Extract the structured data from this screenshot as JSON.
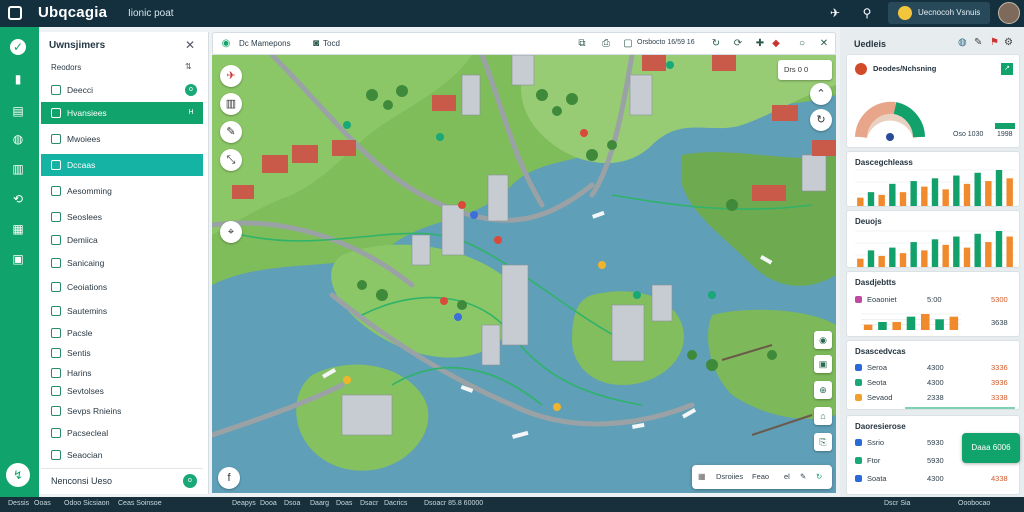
{
  "app": {
    "title": "Ubqcagia",
    "menu": "Iionic poat"
  },
  "topbar": {
    "user_label": "Uecnocoh Vsnuis"
  },
  "sidebar": {
    "title": "Uwnsjimers",
    "section": "Reodors",
    "items": [
      {
        "label": "Deecci",
        "badge": "o",
        "state": ""
      },
      {
        "label": "Hvansiees",
        "badge": "H",
        "state": "sel1"
      },
      {
        "label": "Mwoiees",
        "badge": "",
        "state": ""
      },
      {
        "label": "Dccaas",
        "badge": "",
        "state": "sel2"
      },
      {
        "label": "Aesomming",
        "badge": "",
        "state": ""
      },
      {
        "label": "Seoslees",
        "badge": "",
        "state": ""
      },
      {
        "label": "Demiica",
        "badge": "",
        "state": ""
      },
      {
        "label": "Sanicaing",
        "badge": "",
        "state": ""
      },
      {
        "label": "Ceoiations",
        "badge": "",
        "state": ""
      },
      {
        "label": "Sautemins",
        "badge": "",
        "state": ""
      },
      {
        "label": "Pacsle",
        "badge": "",
        "state": ""
      },
      {
        "label": "Sentis",
        "badge": "",
        "state": ""
      },
      {
        "label": "Harins",
        "badge": "",
        "state": ""
      },
      {
        "label": "Sevtolses",
        "badge": "",
        "state": ""
      },
      {
        "label": "Sevps Rnieins",
        "badge": "",
        "state": ""
      },
      {
        "label": "Pacsecleal",
        "badge": "",
        "state": ""
      },
      {
        "label": "Seaocian",
        "badge": "",
        "state": ""
      }
    ],
    "footer": "Nenconsi Ueso",
    "footer_badge": "o"
  },
  "toolbar": {
    "title": "Dc Mamepons",
    "tag": "Tocd",
    "range": "Orsbocto 16/59 16"
  },
  "map": {
    "chip": "Drs 0 0",
    "legend": [
      "Dsroiies",
      "Feao",
      "el"
    ]
  },
  "right": {
    "title": "Uedleis",
    "card1": {
      "title": "Deodes/Nchsning",
      "left": "Oso 1030",
      "right": "1998"
    },
    "card2": {
      "title": "Dascegchleass"
    },
    "card3": {
      "title": "Deuojs"
    },
    "card4": {
      "title": "Dasdjebtts",
      "row": {
        "name": "Eoaoniet",
        "v1": "5:00",
        "v2": "5300"
      },
      "last": "3638"
    },
    "card5": {
      "title": "Dsascedvcas",
      "rows": [
        {
          "name": "Seroa",
          "v1": "4300",
          "v2": "3336"
        },
        {
          "name": "Seota",
          "v1": "4300",
          "v2": "3936"
        },
        {
          "name": "Sevaod",
          "v1": "2338",
          "v2": "3338"
        }
      ]
    },
    "card6": {
      "title": "Daoresierose",
      "rows": [
        {
          "name": "Ssrio",
          "v1": "5930",
          "v2": ""
        },
        {
          "name": "Ftor",
          "v1": "5930",
          "v2": ""
        },
        {
          "name": "Soata",
          "v1": "4300",
          "v2": "4338"
        }
      ]
    },
    "cta": "Daaa 6006"
  },
  "chart_data": [
    {
      "type": "bar",
      "title": "Dascegchleass",
      "values": [
        3,
        5,
        4,
        8,
        5,
        9,
        7,
        10,
        6,
        11,
        8,
        12,
        9,
        13,
        10
      ],
      "colors": [
        "#f08a2c",
        "#12a06b"
      ]
    },
    {
      "type": "bar",
      "title": "Deuojs",
      "values": [
        3,
        6,
        4,
        7,
        5,
        9,
        6,
        10,
        8,
        11,
        7,
        12,
        9,
        13,
        11
      ],
      "colors": [
        "#f08a2c",
        "#12a06b"
      ]
    },
    {
      "type": "bar",
      "title": "Dasdjebtts",
      "values": [
        2,
        3,
        3,
        5,
        6,
        4,
        5
      ],
      "colors": [
        "#f08a2c",
        "#12a06b"
      ]
    }
  ],
  "statusbar": [
    "Dessis",
    "Ooas",
    "Odoo Sicsiaon",
    "Ceas Soinsoe",
    "Deapys",
    "Dooa",
    "Dsoa",
    "Daarg",
    "Doas",
    "Dsacr",
    "Dacrics",
    "Dsoacr 85.8 60000",
    "Dscr Sia",
    "Ooobocao"
  ]
}
